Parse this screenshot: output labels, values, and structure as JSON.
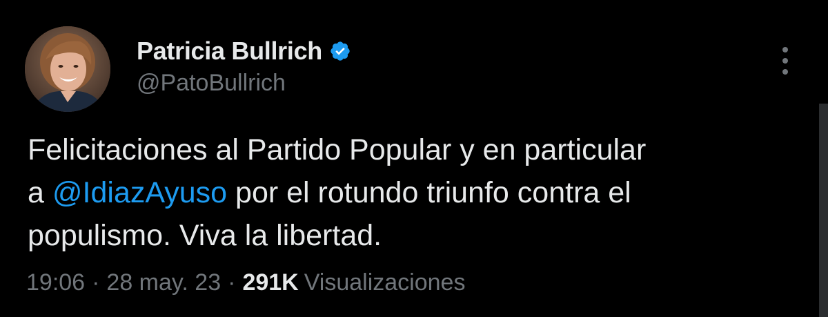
{
  "author": {
    "display_name": "Patricia Bullrich",
    "handle": "@PatoBullrich",
    "verified": true
  },
  "tweet": {
    "text_part1": "Felicitaciones al Partido Popular y en particular",
    "text_part2": "a ",
    "mention": "@IdiazAyuso",
    "text_part3": " por el rotundo triunfo contra el",
    "text_part4": "populismo. Viva la libertad."
  },
  "meta": {
    "time": "19:06",
    "separator": "·",
    "date": "28 may. 23",
    "views_count": "291K",
    "views_label": "Visualizaciones"
  },
  "icons": {
    "verified": "verified-badge-icon",
    "more": "more-options-icon"
  },
  "colors": {
    "background": "#000000",
    "primary_text": "#e7e9ea",
    "secondary_text": "#71767b",
    "accent": "#1d9bf0"
  }
}
